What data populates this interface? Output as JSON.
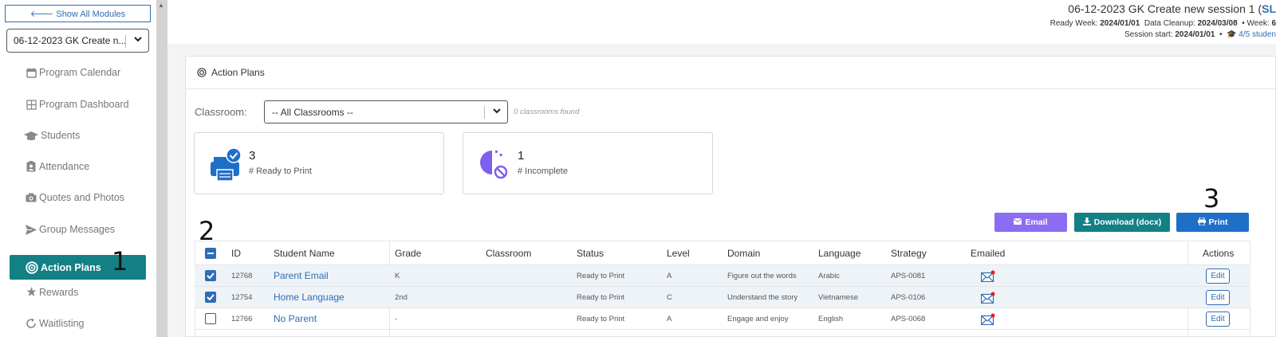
{
  "sidebar": {
    "show_all_label": "🡐 Show All Modules",
    "session_value": "06-12-2023 GK Create n...",
    "items": [
      {
        "label": "Program Calendar",
        "icon": "calendar-icon"
      },
      {
        "label": "Program Dashboard",
        "icon": "grid-icon"
      },
      {
        "label": "Students",
        "icon": "graduation-cap-icon"
      },
      {
        "label": "Attendance",
        "icon": "clipboard-user-icon"
      },
      {
        "label": "Quotes and Photos",
        "icon": "camera-icon"
      },
      {
        "label": "Group Messages",
        "icon": "paper-plane-icon"
      },
      {
        "label": "Action Plans",
        "icon": "bullseye-icon",
        "active": true
      },
      {
        "label": "Rewards",
        "icon": "star-icon"
      },
      {
        "label": "Waitlisting",
        "icon": "refresh-icon"
      }
    ]
  },
  "header": {
    "title_prefix": "06-12-2023 GK Create new session 1 (",
    "title_link": "SL",
    "meta1_ready_label": "Ready Week: ",
    "meta1_ready_value": "2024/01/01",
    "meta1_cleanup_label": "Data Cleanup: ",
    "meta1_cleanup_value": "2024/03/08",
    "meta1_week_label": "•  Week: ",
    "meta1_week_value": "6",
    "meta2_start_label": "Session start: ",
    "meta2_start_value": "2024/01/01",
    "meta2_students": "🎓 4/5 studen"
  },
  "panel": {
    "title": "Action Plans",
    "classroom_label": "Classroom:",
    "classroom_value": "-- All Classrooms --",
    "classroom_count": "0 classrooms found",
    "cards": [
      {
        "value": "3",
        "label": "# Ready to Print"
      },
      {
        "value": "1",
        "label": "# Incomplete"
      }
    ],
    "buttons": {
      "email": "Email",
      "download": "Download (docx)",
      "print": "Print"
    }
  },
  "annotations": {
    "one": "1",
    "two": "2",
    "three": "3"
  },
  "colors": {
    "active_nav": "#138085",
    "email_button": "#8b6cf2",
    "download_button": "#138085",
    "print_button": "#1f6fc9",
    "link": "#2f6db5"
  },
  "table": {
    "headers": [
      "ID",
      "Student Name",
      "Grade",
      "Classroom",
      "Status",
      "Level",
      "Domain",
      "Language",
      "Strategy",
      "Emailed",
      "Actions"
    ],
    "rows": [
      {
        "checked": true,
        "id": "12768",
        "name": "Parent Email",
        "grade": "K",
        "classroom": "",
        "status": "Ready to Print",
        "level": "A",
        "domain": "Figure out the words",
        "language": "Arabic",
        "strategy": "APS-0081",
        "action": "Edit"
      },
      {
        "checked": true,
        "id": "12754",
        "name": "Home Language",
        "grade": "2nd",
        "classroom": "",
        "status": "Ready to Print",
        "level": "C",
        "domain": "Understand the story",
        "language": "Vietnamese",
        "strategy": "APS-0106",
        "action": "Edit"
      },
      {
        "checked": false,
        "id": "12766",
        "name": "No Parent",
        "grade": "-",
        "classroom": "",
        "status": "Ready to Print",
        "level": "A",
        "domain": "Engage and enjoy",
        "language": "English",
        "strategy": "APS-0068",
        "action": "Edit"
      }
    ]
  }
}
